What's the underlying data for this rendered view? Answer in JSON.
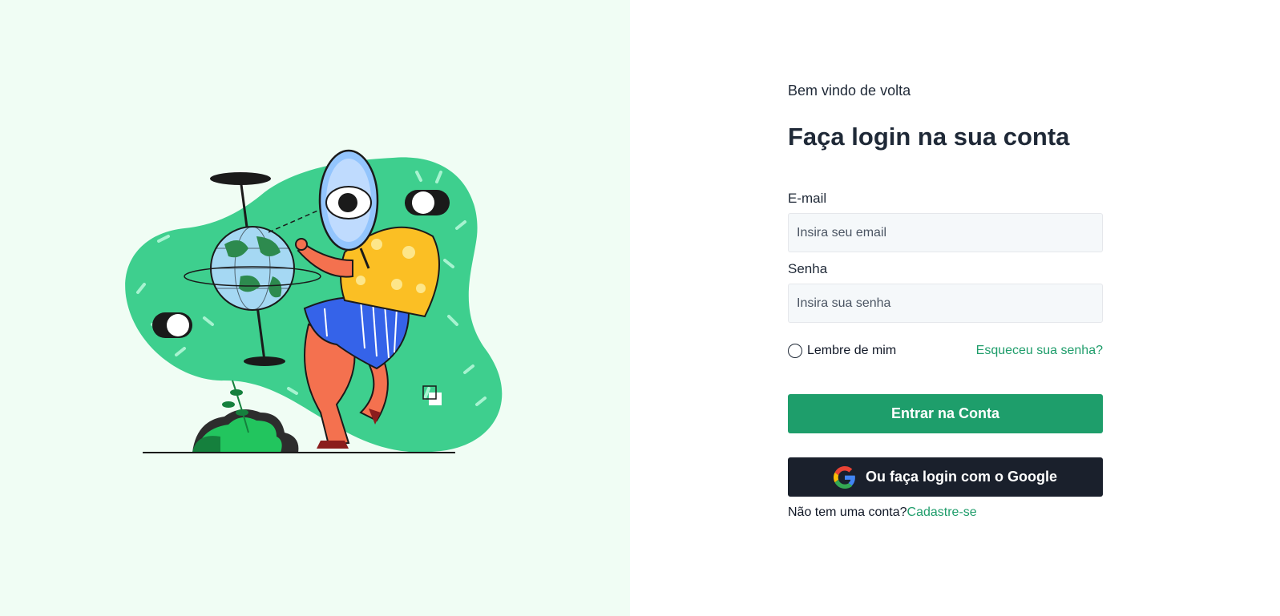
{
  "login": {
    "welcome": "Bem vindo de volta",
    "title": "Faça login na sua conta",
    "email_label": "E-mail",
    "email_placeholder": "Insira seu email",
    "email_value": "",
    "password_label": "Senha",
    "password_placeholder": "Insira sua senha",
    "password_value": "",
    "remember_label": "Lembre de mim",
    "remember_checked": false,
    "forgot_label": "Esqueceu sua senha?",
    "submit_label": "Entrar na Conta",
    "google_label": "Ou faça login com o Google",
    "signup_prompt": "Não tem uma conta?",
    "signup_link": "Cadastre-se"
  },
  "colors": {
    "left_background": "#f0fdf4",
    "accent_green": "#1e9e6b",
    "google_button": "#1a202c",
    "input_background": "#f5f8fa"
  },
  "icons": {
    "google": "google-g-icon",
    "illustration": "explorer-globe-illustration"
  }
}
